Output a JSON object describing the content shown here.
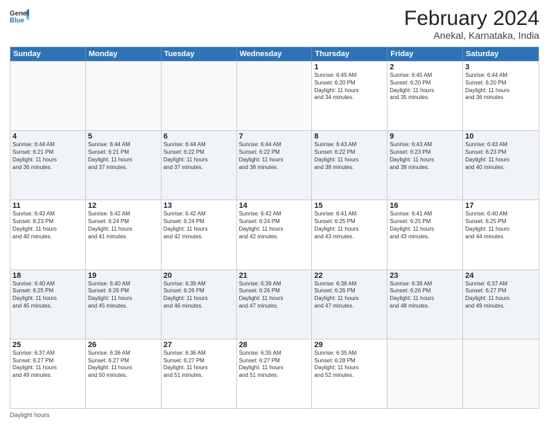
{
  "logo": {
    "line1": "General",
    "line2": "Blue"
  },
  "title": "February 2024",
  "subtitle": "Anekal, Karnataka, India",
  "header_days": [
    "Sunday",
    "Monday",
    "Tuesday",
    "Wednesday",
    "Thursday",
    "Friday",
    "Saturday"
  ],
  "footer": "Daylight hours",
  "weeks": [
    [
      {
        "day": "",
        "empty": true
      },
      {
        "day": "",
        "empty": true
      },
      {
        "day": "",
        "empty": true
      },
      {
        "day": "",
        "empty": true
      },
      {
        "day": "1",
        "lines": [
          "Sunrise: 6:45 AM",
          "Sunset: 6:20 PM",
          "Daylight: 11 hours",
          "and 34 minutes."
        ]
      },
      {
        "day": "2",
        "lines": [
          "Sunrise: 6:45 AM",
          "Sunset: 6:20 PM",
          "Daylight: 11 hours",
          "and 35 minutes."
        ]
      },
      {
        "day": "3",
        "lines": [
          "Sunrise: 6:44 AM",
          "Sunset: 6:20 PM",
          "Daylight: 11 hours",
          "and 36 minutes."
        ]
      }
    ],
    [
      {
        "day": "4",
        "lines": [
          "Sunrise: 6:44 AM",
          "Sunset: 6:21 PM",
          "Daylight: 11 hours",
          "and 36 minutes."
        ]
      },
      {
        "day": "5",
        "lines": [
          "Sunrise: 6:44 AM",
          "Sunset: 6:21 PM",
          "Daylight: 11 hours",
          "and 37 minutes."
        ]
      },
      {
        "day": "6",
        "lines": [
          "Sunrise: 6:44 AM",
          "Sunset: 6:22 PM",
          "Daylight: 11 hours",
          "and 37 minutes."
        ]
      },
      {
        "day": "7",
        "lines": [
          "Sunrise: 6:44 AM",
          "Sunset: 6:22 PM",
          "Daylight: 11 hours",
          "and 38 minutes."
        ]
      },
      {
        "day": "8",
        "lines": [
          "Sunrise: 6:43 AM",
          "Sunset: 6:22 PM",
          "Daylight: 11 hours",
          "and 38 minutes."
        ]
      },
      {
        "day": "9",
        "lines": [
          "Sunrise: 6:43 AM",
          "Sunset: 6:23 PM",
          "Daylight: 11 hours",
          "and 39 minutes."
        ]
      },
      {
        "day": "10",
        "lines": [
          "Sunrise: 6:43 AM",
          "Sunset: 6:23 PM",
          "Daylight: 11 hours",
          "and 40 minutes."
        ]
      }
    ],
    [
      {
        "day": "11",
        "lines": [
          "Sunrise: 6:43 AM",
          "Sunset: 6:23 PM",
          "Daylight: 11 hours",
          "and 40 minutes."
        ]
      },
      {
        "day": "12",
        "lines": [
          "Sunrise: 6:42 AM",
          "Sunset: 6:24 PM",
          "Daylight: 11 hours",
          "and 41 minutes."
        ]
      },
      {
        "day": "13",
        "lines": [
          "Sunrise: 6:42 AM",
          "Sunset: 6:24 PM",
          "Daylight: 11 hours",
          "and 42 minutes."
        ]
      },
      {
        "day": "14",
        "lines": [
          "Sunrise: 6:42 AM",
          "Sunset: 6:24 PM",
          "Daylight: 11 hours",
          "and 42 minutes."
        ]
      },
      {
        "day": "15",
        "lines": [
          "Sunrise: 6:41 AM",
          "Sunset: 6:25 PM",
          "Daylight: 11 hours",
          "and 43 minutes."
        ]
      },
      {
        "day": "16",
        "lines": [
          "Sunrise: 6:41 AM",
          "Sunset: 6:25 PM",
          "Daylight: 11 hours",
          "and 43 minutes."
        ]
      },
      {
        "day": "17",
        "lines": [
          "Sunrise: 6:40 AM",
          "Sunset: 6:25 PM",
          "Daylight: 11 hours",
          "and 44 minutes."
        ]
      }
    ],
    [
      {
        "day": "18",
        "lines": [
          "Sunrise: 6:40 AM",
          "Sunset: 6:25 PM",
          "Daylight: 11 hours",
          "and 45 minutes."
        ]
      },
      {
        "day": "19",
        "lines": [
          "Sunrise: 6:40 AM",
          "Sunset: 6:26 PM",
          "Daylight: 11 hours",
          "and 45 minutes."
        ]
      },
      {
        "day": "20",
        "lines": [
          "Sunrise: 6:39 AM",
          "Sunset: 6:26 PM",
          "Daylight: 11 hours",
          "and 46 minutes."
        ]
      },
      {
        "day": "21",
        "lines": [
          "Sunrise: 6:39 AM",
          "Sunset: 6:26 PM",
          "Daylight: 11 hours",
          "and 47 minutes."
        ]
      },
      {
        "day": "22",
        "lines": [
          "Sunrise: 6:38 AM",
          "Sunset: 6:26 PM",
          "Daylight: 11 hours",
          "and 47 minutes."
        ]
      },
      {
        "day": "23",
        "lines": [
          "Sunrise: 6:38 AM",
          "Sunset: 6:26 PM",
          "Daylight: 11 hours",
          "and 48 minutes."
        ]
      },
      {
        "day": "24",
        "lines": [
          "Sunrise: 6:37 AM",
          "Sunset: 6:27 PM",
          "Daylight: 11 hours",
          "and 49 minutes."
        ]
      }
    ],
    [
      {
        "day": "25",
        "lines": [
          "Sunrise: 6:37 AM",
          "Sunset: 6:27 PM",
          "Daylight: 11 hours",
          "and 49 minutes."
        ]
      },
      {
        "day": "26",
        "lines": [
          "Sunrise: 6:36 AM",
          "Sunset: 6:27 PM",
          "Daylight: 11 hours",
          "and 50 minutes."
        ]
      },
      {
        "day": "27",
        "lines": [
          "Sunrise: 6:36 AM",
          "Sunset: 6:27 PM",
          "Daylight: 11 hours",
          "and 51 minutes."
        ]
      },
      {
        "day": "28",
        "lines": [
          "Sunrise: 6:35 AM",
          "Sunset: 6:27 PM",
          "Daylight: 11 hours",
          "and 51 minutes."
        ]
      },
      {
        "day": "29",
        "lines": [
          "Sunrise: 6:35 AM",
          "Sunset: 6:28 PM",
          "Daylight: 11 hours",
          "and 52 minutes."
        ]
      },
      {
        "day": "",
        "empty": true
      },
      {
        "day": "",
        "empty": true
      }
    ]
  ]
}
